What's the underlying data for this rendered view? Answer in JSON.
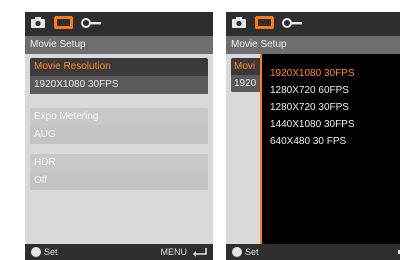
{
  "colors": {
    "accent": "#ff7a1c",
    "bar_dark": "#2e2e2e",
    "title_bg": "#6e6e6e",
    "panel_bg": "#d9d9d9"
  },
  "left_screen": {
    "tabs": [
      "camera-icon",
      "movie-icon",
      "wrench-icon"
    ],
    "active_tab": "movie-icon",
    "title": "Movie Setup",
    "items": [
      {
        "label": "Movie Resolution",
        "value": "1920X1080 30FPS",
        "state": "selected"
      },
      {
        "label": "Expo Metering",
        "value": "AUG",
        "state": "normal"
      },
      {
        "label": "HDR",
        "value": "Off",
        "state": "normal"
      }
    ],
    "bottom": {
      "set_label": "Set",
      "menu_label": "MENU"
    }
  },
  "right_screen": {
    "title": "Movie Setup",
    "peek_label": "Movi",
    "peek_value": "1920",
    "options": [
      "1920X1080 30FPS",
      "1280X720 60FPS",
      "1280X720 30FPS",
      "1440X1080 30FPS",
      "640X480 30 FPS"
    ],
    "selected_option": "1920X1080 30FPS",
    "bottom": {
      "set_label": "Set"
    }
  }
}
